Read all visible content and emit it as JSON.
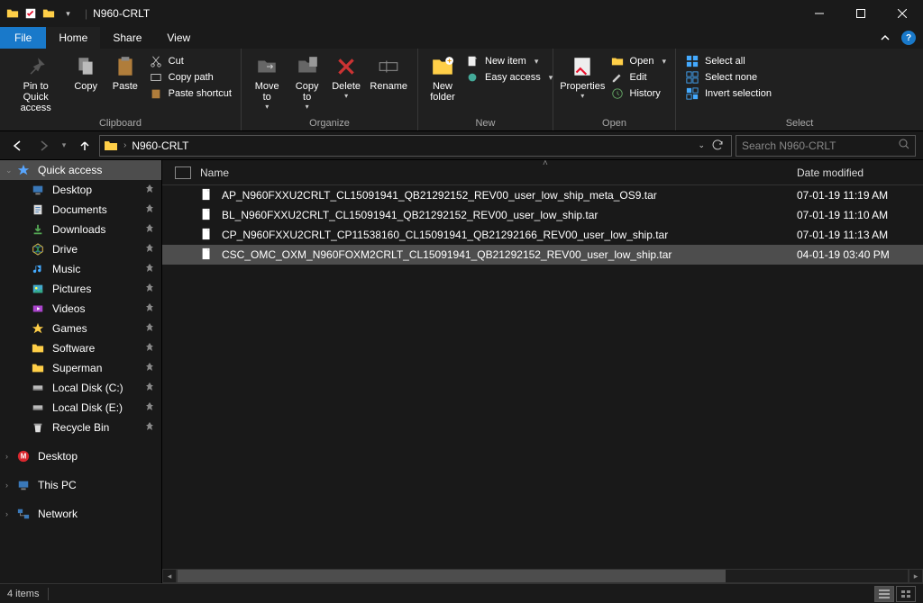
{
  "window": {
    "title": "N960-CRLT"
  },
  "tabs": {
    "file": "File",
    "home": "Home",
    "share": "Share",
    "view": "View"
  },
  "ribbon": {
    "clipboard": {
      "label": "Clipboard",
      "pin": "Pin to Quick access",
      "copy": "Copy",
      "paste": "Paste",
      "cut": "Cut",
      "copypath": "Copy path",
      "pasteshortcut": "Paste shortcut"
    },
    "organize": {
      "label": "Organize",
      "moveto": "Move to",
      "copyto": "Copy to",
      "delete": "Delete",
      "rename": "Rename"
    },
    "new": {
      "label": "New",
      "newfolder": "New folder",
      "newitem": "New item",
      "easyaccess": "Easy access"
    },
    "open": {
      "label": "Open",
      "properties": "Properties",
      "open": "Open",
      "edit": "Edit",
      "history": "History"
    },
    "select": {
      "label": "Select",
      "selectall": "Select all",
      "selectnone": "Select none",
      "invert": "Invert selection"
    }
  },
  "addressbar": {
    "path": "N960-CRLT",
    "search_placeholder": "Search N960-CRLT"
  },
  "columns": {
    "name": "Name",
    "date": "Date modified"
  },
  "sidebar": {
    "quick": "Quick access",
    "items": [
      {
        "label": "Desktop"
      },
      {
        "label": "Documents"
      },
      {
        "label": "Downloads"
      },
      {
        "label": "Drive"
      },
      {
        "label": "Music"
      },
      {
        "label": "Pictures"
      },
      {
        "label": "Videos"
      },
      {
        "label": "Games"
      },
      {
        "label": "Software"
      },
      {
        "label": "Superman"
      },
      {
        "label": "Local Disk (C:)"
      },
      {
        "label": "Local Disk (E:)"
      },
      {
        "label": "Recycle Bin"
      }
    ],
    "desktop2": "Desktop",
    "thispc": "This PC",
    "network": "Network"
  },
  "files": [
    {
      "name": "AP_N960FXXU2CRLT_CL15091941_QB21292152_REV00_user_low_ship_meta_OS9.tar",
      "date": "07-01-19 11:19 AM"
    },
    {
      "name": "BL_N960FXXU2CRLT_CL15091941_QB21292152_REV00_user_low_ship.tar",
      "date": "07-01-19 11:10 AM"
    },
    {
      "name": "CP_N960FXXU2CRLT_CP11538160_CL15091941_QB21292166_REV00_user_low_ship.tar",
      "date": "07-01-19 11:13 AM"
    },
    {
      "name": "CSC_OMC_OXM_N960FOXM2CRLT_CL15091941_QB21292152_REV00_user_low_ship.tar",
      "date": "04-01-19 03:40 PM"
    }
  ],
  "statusbar": {
    "count": "4 items"
  }
}
